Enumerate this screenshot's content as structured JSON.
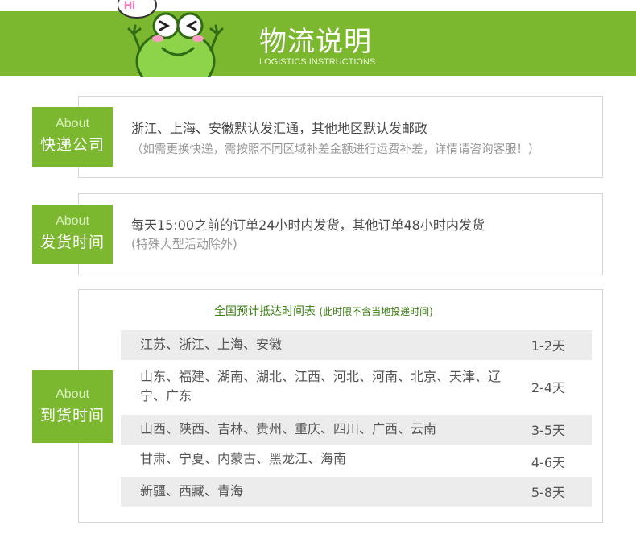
{
  "header": {
    "title": "物流说明",
    "subtitle": "LOGISTICS INSTRUCTIONS",
    "badge_text": "Hi"
  },
  "colors": {
    "brand_green": "#7cb82f",
    "row_shade": "#ececec",
    "table_title": "#3b7f12"
  },
  "sections": {
    "courier": {
      "about": "About",
      "label": "快递公司",
      "main": "浙江、上海、安徽默认发汇通，其他地区默认发邮政",
      "note": "（如需更换快递，需按照不同区域补差金额进行运费补差，详情请咨询客服！）"
    },
    "ship_time": {
      "about": "About",
      "label": "发货时间",
      "main": "每天15:00之前的订单24小时内发货，其他订单48小时内发货",
      "note": "(特殊大型活动除外)"
    },
    "arrival": {
      "about": "About",
      "label": "到货时间",
      "table_title": "全国预计抵达时间表",
      "table_note": "(此时限不含当地投递时间)",
      "rows": [
        {
          "regions": "江苏、浙江、上海、安徽",
          "days": "1-2天"
        },
        {
          "regions": "山东、福建、湖南、湖北、江西、河北、河南、北京、天津、辽宁、广东",
          "days": "2-4天"
        },
        {
          "regions": "山西、陕西、吉林、贵州、重庆、四川、广西、云南",
          "days": "3-5天"
        },
        {
          "regions": "甘肃、宁夏、内蒙古、黑龙江、海南",
          "days": "4-6天"
        },
        {
          "regions": "新疆、西藏、青海",
          "days": "5-8天"
        }
      ]
    }
  }
}
